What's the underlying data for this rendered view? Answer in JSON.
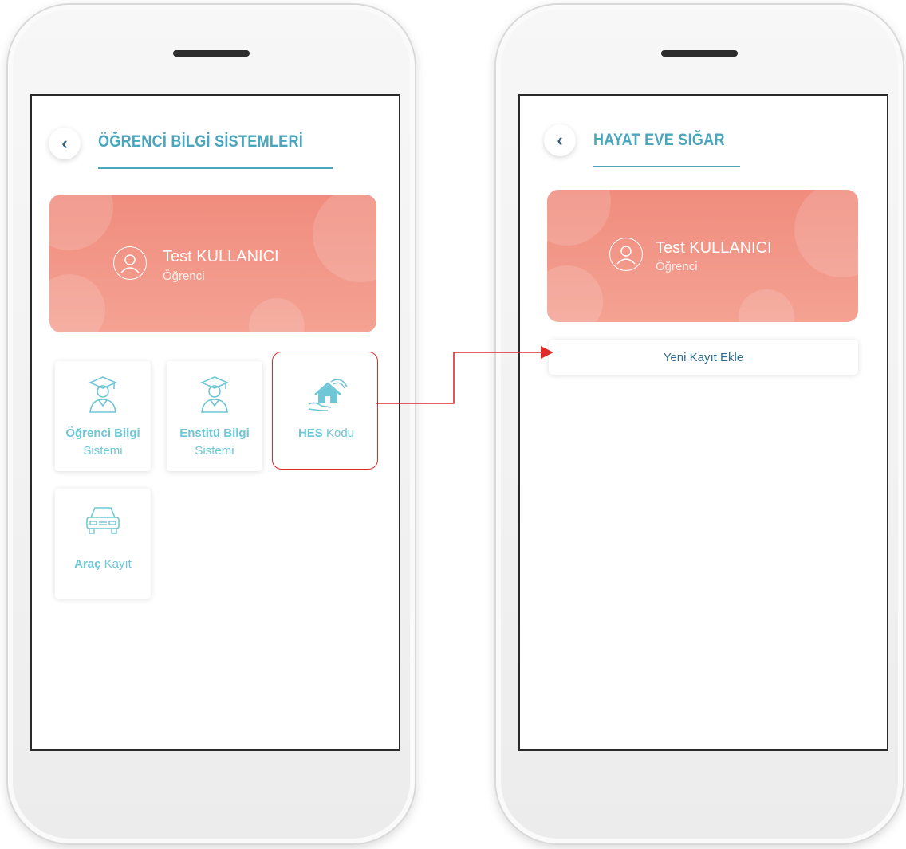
{
  "accent_color": "#4aa6bd",
  "card_color": "#f08c7e",
  "highlight_color": "#e02a2a",
  "left_screen": {
    "back_icon": "chevron-left-icon",
    "title": "ÖĞRENCİ BİLGİ SİSTEMLERİ",
    "profile": {
      "icon": "user-circle-icon",
      "name": "Test KULLANICI",
      "role": "Öğrenci"
    },
    "tiles": [
      {
        "icon": "graduate-icon",
        "label_bold": "Öğrenci Bilgi",
        "label_rest": "Sistemi"
      },
      {
        "icon": "graduate-icon",
        "label_bold": "Enstitü Bilgi",
        "label_rest": "Sistemi"
      },
      {
        "icon": "house-hands-icon",
        "label_bold": "HES",
        "label_rest": "Kodu"
      },
      {
        "icon": "car-icon",
        "label_bold": "Araç",
        "label_rest": "Kayıt"
      }
    ]
  },
  "right_screen": {
    "back_icon": "chevron-left-icon",
    "title": "HAYAT EVE SIĞAR",
    "profile": {
      "icon": "user-circle-icon",
      "name": "Test KULLANICI",
      "role": "Öğrenci"
    },
    "add_button": "Yeni Kayıt Ekle"
  }
}
